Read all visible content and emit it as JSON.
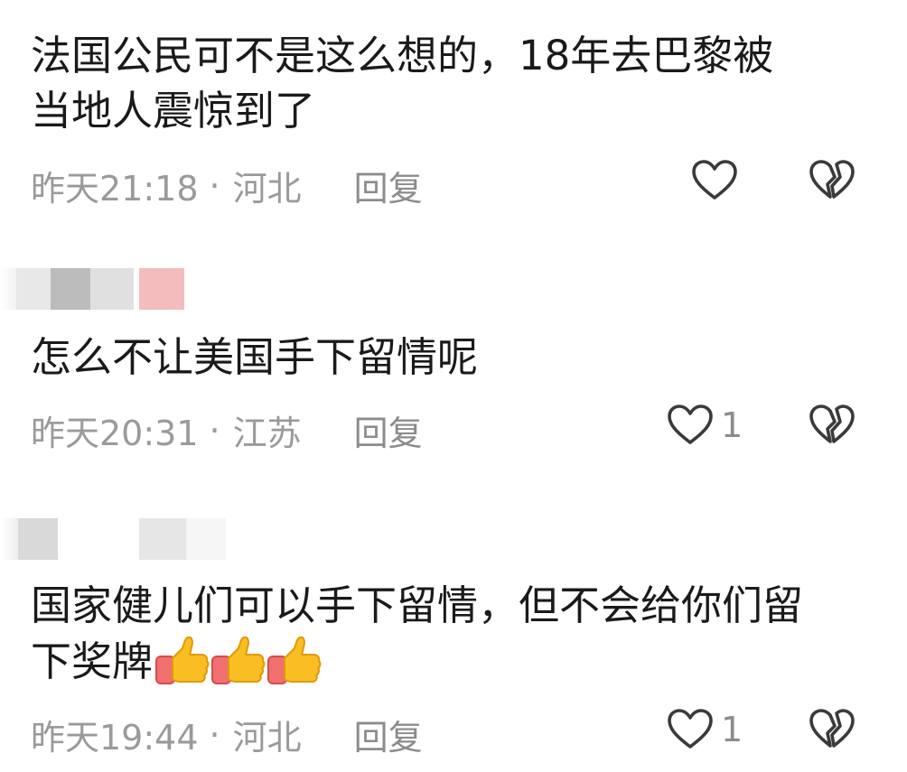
{
  "comments": [
    {
      "text_line1": "法国公民可不是这么想的，18年去巴黎被",
      "text_line2": "当地人震惊到了",
      "time": "昨天21:18",
      "dot": "·",
      "location": "河北",
      "reply": "回复",
      "like_count": ""
    },
    {
      "text_line1": "怎么不让美国手下留情呢",
      "time": "昨天20:31",
      "dot": "·",
      "location": "江苏",
      "reply": "回复",
      "like_count": "1"
    },
    {
      "text_line1": "国家健儿们可以手下留情，但不会给你们留",
      "text_line2": "下奖牌",
      "emoji": "thumbs-up-emoji",
      "time": "昨天19:44",
      "dot": "·",
      "location": "河北",
      "reply": "回复",
      "like_count": "1"
    }
  ],
  "icons": {
    "like": "heart-outline-icon",
    "dislike": "broken-heart-icon"
  },
  "colors": {
    "meta": "#9a9a9a",
    "icon": "#3a3a3a",
    "thumb": "#f6b417"
  }
}
